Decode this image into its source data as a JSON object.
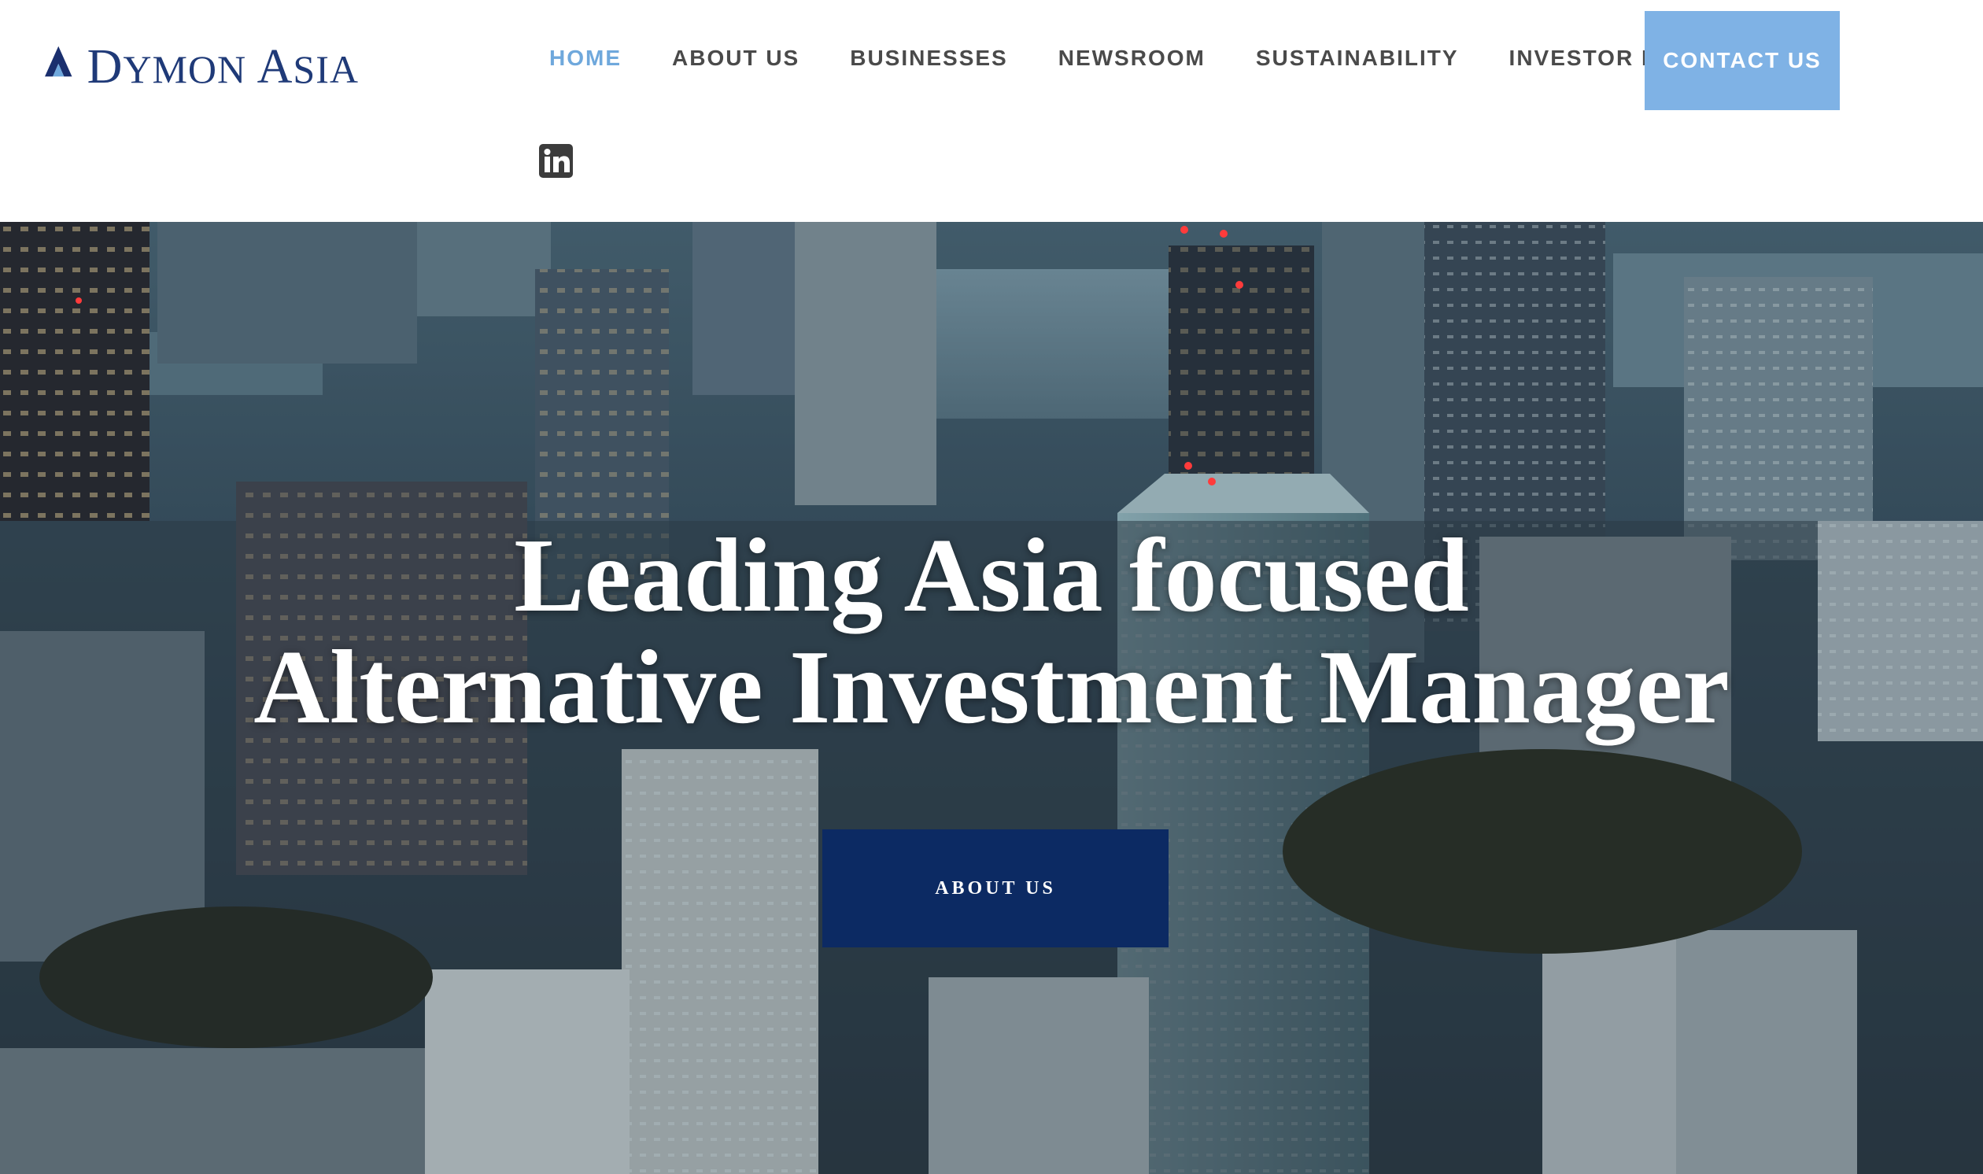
{
  "brand": {
    "name_first_letter_1": "D",
    "name_rest_1": "YMON",
    "name_first_letter_2": "A",
    "name_rest_2": "SIA",
    "color": "#1f3a78"
  },
  "nav": {
    "items": [
      {
        "label": "HOME",
        "active": true
      },
      {
        "label": "ABOUT US",
        "active": false
      },
      {
        "label": "BUSINESSES",
        "active": false
      },
      {
        "label": "NEWSROOM",
        "active": false
      },
      {
        "label": "SUSTAINABILITY",
        "active": false
      },
      {
        "label": "INVESTOR LOGIN",
        "active": false
      }
    ],
    "contact_label": "CONTACT US",
    "active_color": "#6fa8dc",
    "contact_color": "#7fb2e5",
    "social_icon": "linkedin-icon"
  },
  "hero": {
    "title_line1": "Leading Asia focused",
    "title_line2": "Alternative Investment Manager",
    "cta_label": "ABOUT US",
    "cta_color": "#0c2a63"
  }
}
